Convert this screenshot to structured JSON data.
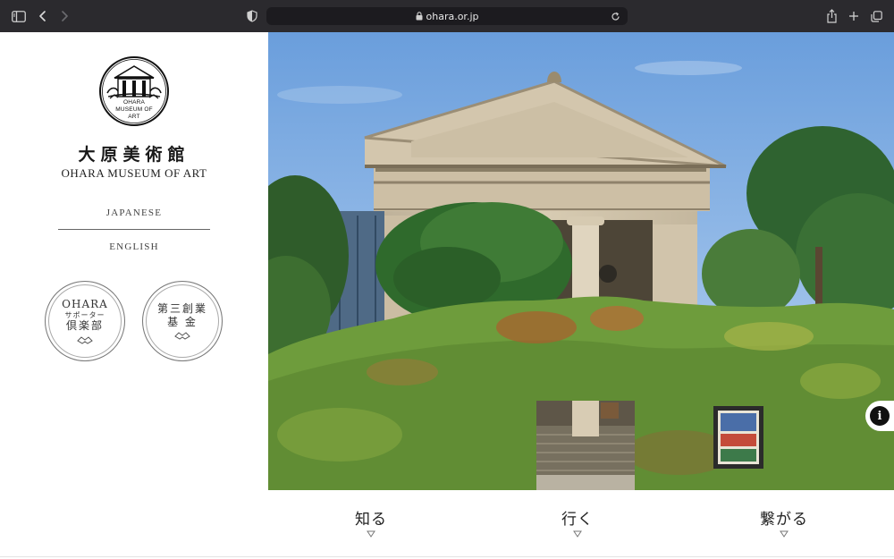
{
  "browser": {
    "url": "ohara.or.jp"
  },
  "sidebar": {
    "logo_text": "OHARA MUSEUM OF ART",
    "title_jp": "大原美術館",
    "title_en": "OHARA MUSEUM OF ART",
    "lang_japanese": "JAPANESE",
    "lang_english": "ENGLISH",
    "supporters_club": {
      "line1": "OHARA",
      "line2": "サポーター",
      "line3": "倶楽部"
    },
    "foundation": {
      "line1": "第三創業",
      "line2": "基 金"
    }
  },
  "nav": {
    "items": [
      {
        "label": "知る"
      },
      {
        "label": "行く"
      },
      {
        "label": "繋がる"
      }
    ]
  },
  "info_label": "i",
  "colors": {
    "chrome": "#2b2a2e",
    "address_bar": "#1c1b1f",
    "sky": "#7aa8e0",
    "ivy": "#6d9a3a",
    "stone": "#cbbfa6"
  }
}
